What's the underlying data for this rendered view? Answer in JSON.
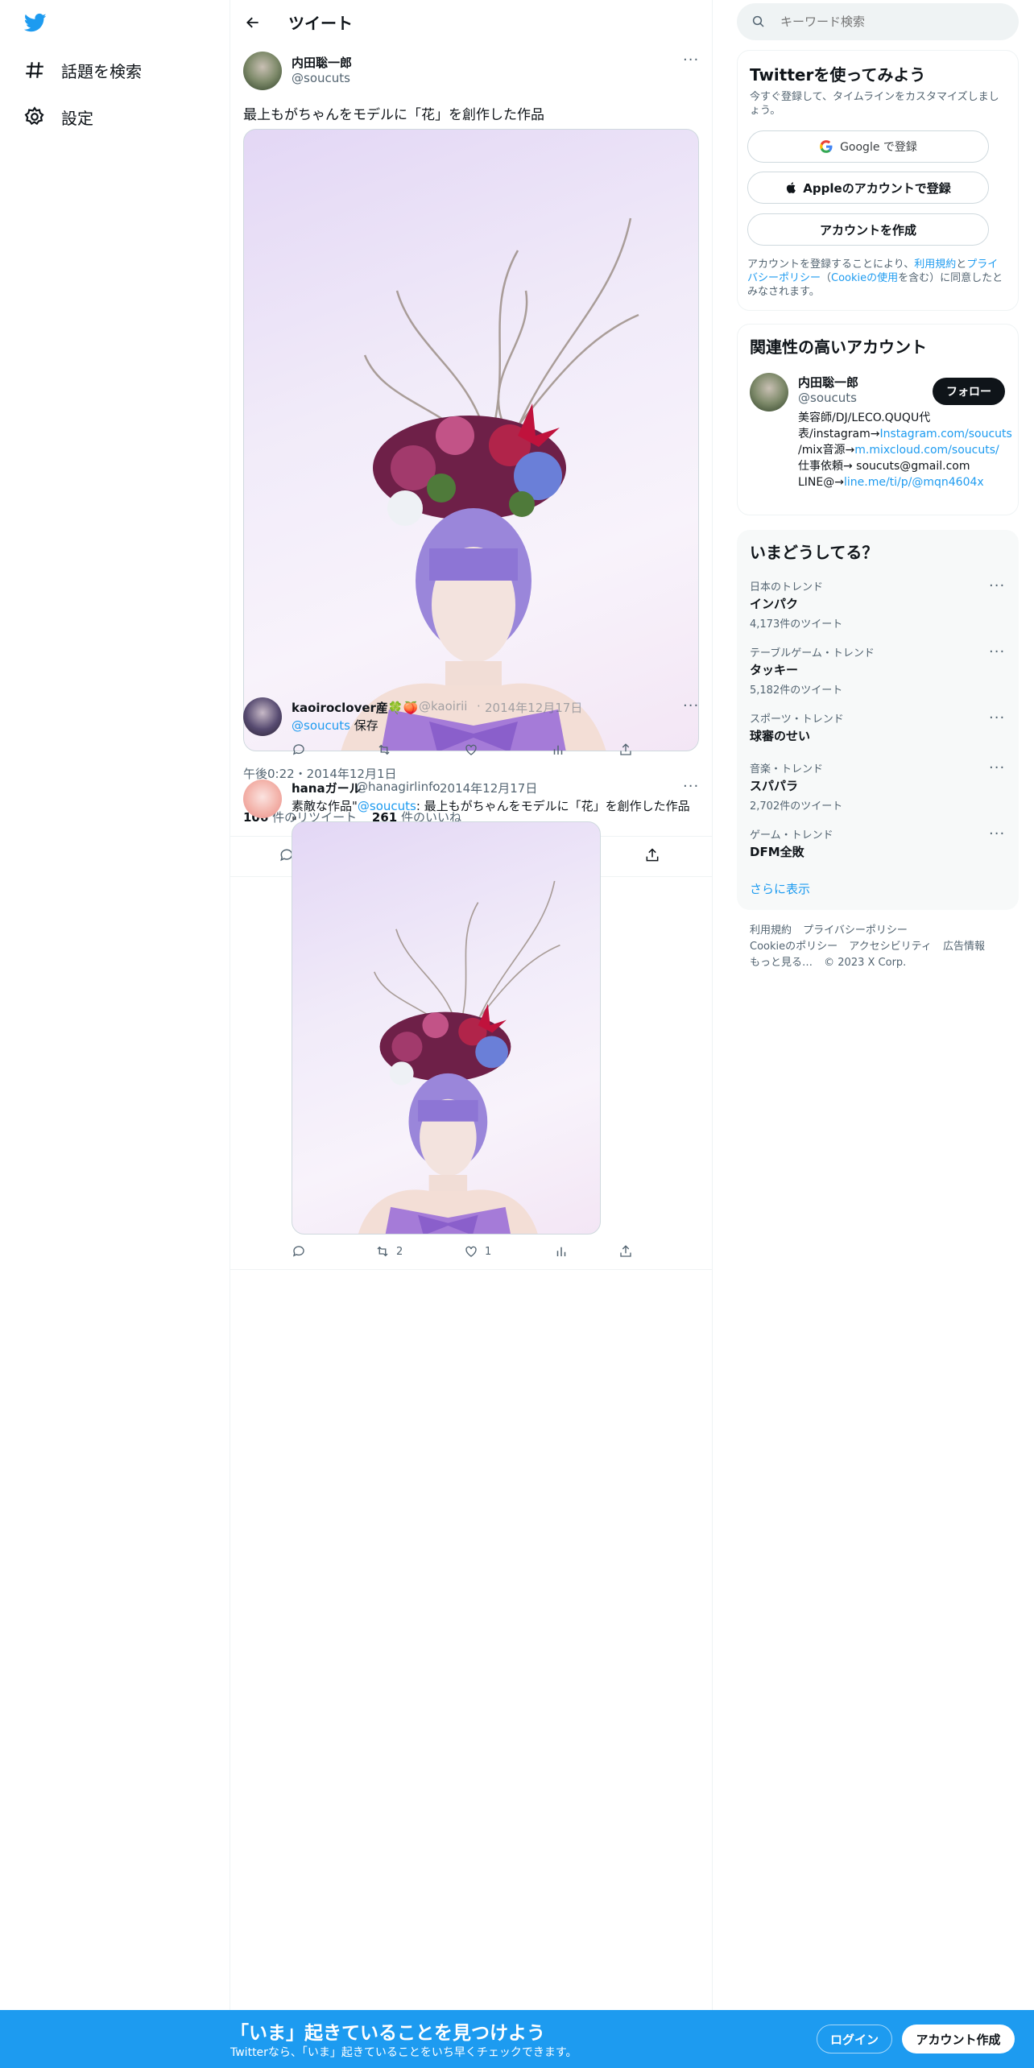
{
  "sidebar": {
    "items": [
      {
        "label": "話題を検索",
        "icon": "hashtag-icon"
      },
      {
        "label": "設定",
        "icon": "gear-icon"
      }
    ]
  },
  "header": {
    "title": "ツイート",
    "back_icon": "back-arrow-icon"
  },
  "main_tweet": {
    "author_name": "内田聡一郎",
    "author_handle": "@soucuts",
    "text": "最上もがちゃんをモデルに「花」を創作した作品",
    "timestamp": "午後0:22・2014年12月1日",
    "retweets": "106",
    "retweets_label": "件のリツイート",
    "likes": "261",
    "likes_label": "件のいいね"
  },
  "reply_1": {
    "author_name": "kaoiroclover産🍀🍑",
    "author_handle": "@kaoirii",
    "date": "2014年12月17日",
    "mention": "@soucuts",
    "text": "保存"
  },
  "reply_2": {
    "author_name": "hanaガール",
    "author_handle": "@hanagirlinfo",
    "date": "2014年12月17日",
    "text_prefix": "素敵な作品\"",
    "mention": "@soucuts",
    "text_suffix": ": 最上もがちゃんをモデルに「花」を創作した作品 \"",
    "retweets": "2",
    "likes": "1"
  },
  "search": {
    "placeholder": "キーワード検索"
  },
  "signup": {
    "title": "Twitterを使ってみよう",
    "subtitle": "今すぐ登録して、タイムラインをカスタマイズしましょう。",
    "google_button": "Google で登録",
    "apple_button": "Appleのアカウントで登録",
    "create_button": "アカウントを作成",
    "legal_prefix": "アカウントを登録することにより、",
    "terms": "利用規約",
    "and": "と",
    "privacy": "プライバシーポリシー",
    "cookie_open": "（",
    "cookie": "Cookieの使用",
    "legal_suffix": "を含む）に同意したとみなされます。"
  },
  "related": {
    "title": "関連性の高いアカウント",
    "name": "内田聡一郎",
    "handle": "@soucuts",
    "follow_button": "フォロー",
    "bio_1": "美容師/DJ/LECO.QUQU代表/instagram→",
    "bio_link_1": "Instagram.com/soucuts",
    "bio_2": " /mix音源→",
    "bio_link_2": "m.mixcloud.com/soucuts/",
    "bio_3": " 仕事依頼→ soucuts@gmail.com LINE@→",
    "bio_link_3": "line.me/ti/p/@mqn4604x"
  },
  "trends": {
    "title": "いまどうしてる？",
    "items": [
      {
        "category": "日本のトレンド",
        "title": "インパク",
        "count": "4,173件のツイート"
      },
      {
        "category": "テーブルゲーム・トレンド",
        "title": "タッキー",
        "count": "5,182件のツイート"
      },
      {
        "category": "スポーツ・トレンド",
        "title": "球審のせい",
        "count": ""
      },
      {
        "category": "音楽・トレンド",
        "title": "スパパラ",
        "count": "2,702件のツイート"
      },
      {
        "category": "ゲーム・トレンド",
        "title": "DFM全敗",
        "count": ""
      }
    ],
    "show_more": "さらに表示"
  },
  "footer": {
    "terms": "利用規約",
    "privacy": "プライバシーポリシー",
    "cookie": "Cookieのポリシー",
    "accessibility": "アクセシビリティ",
    "ads": "広告情報",
    "more": "もっと見る…",
    "copyright": "© 2023 X Corp."
  },
  "bottom_bar": {
    "title": "「いま」起きていることを見つけよう",
    "subtitle": "Twitterなら、「いま」起きていることをいち早くチェックできます。",
    "login_button": "ログイン",
    "signup_button": "アカウント作成"
  },
  "colors": {
    "brand": "#1d9bf0",
    "text": "#0f1419",
    "muted": "#536471",
    "banner": "#1d9bf0"
  }
}
